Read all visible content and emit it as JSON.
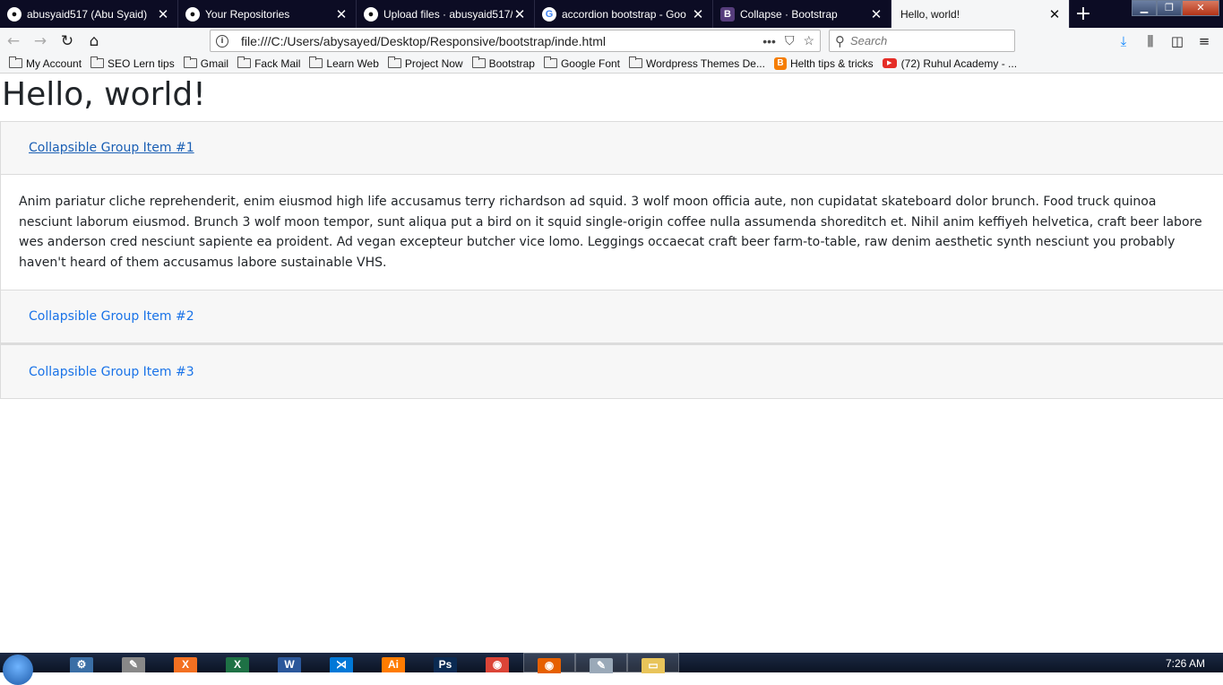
{
  "tabs": [
    {
      "title": "abusyaid517 (Abu Syaid)",
      "icon": "github-icon",
      "active": false
    },
    {
      "title": "Your Repositories",
      "icon": "github-icon",
      "active": false
    },
    {
      "title": "Upload files · abusyaid517/",
      "icon": "github-icon",
      "active": false
    },
    {
      "title": "accordion bootstrap - Goo",
      "icon": "google-icon",
      "active": false
    },
    {
      "title": "Collapse · Bootstrap",
      "icon": "bootstrap-icon",
      "active": false
    },
    {
      "title": "Hello, world!",
      "icon": "none",
      "active": true
    }
  ],
  "glyphs": {
    "close": "✕",
    "new_tab": "+",
    "minimize": "▁",
    "maximize": "❐",
    "window_close": "✕",
    "back": "←",
    "forward": "→",
    "reload": "↻",
    "home": "⌂",
    "info": "i",
    "more": "•••",
    "pocket": "⛉",
    "star": "☆",
    "search": "⚲",
    "download": "⤓",
    "library": "⫼",
    "sidebar": "◫",
    "menu": "≡",
    "github": "●",
    "google": "G",
    "bootstrap": "B",
    "blogger": "B",
    "youtube": "▶"
  },
  "address_bar": {
    "url": "file:///C:/Users/abysayed/Desktop/Responsive/bootstrap/inde.html"
  },
  "search_bar": {
    "placeholder": "Search"
  },
  "bookmarks": [
    {
      "label": "My Account",
      "icon": "folder-icon"
    },
    {
      "label": "SEO Lern tips",
      "icon": "folder-icon"
    },
    {
      "label": "Gmail",
      "icon": "folder-icon"
    },
    {
      "label": "Fack Mail",
      "icon": "folder-icon"
    },
    {
      "label": "Learn Web",
      "icon": "folder-icon"
    },
    {
      "label": "Project Now",
      "icon": "folder-icon"
    },
    {
      "label": "Bootstrap",
      "icon": "folder-icon"
    },
    {
      "label": "Google Font",
      "icon": "folder-icon"
    },
    {
      "label": "Wordpress Themes De...",
      "icon": "folder-icon"
    },
    {
      "label": "Helth tips & tricks",
      "icon": "blogger-icon"
    },
    {
      "label": "(72) Ruhul Academy - ...",
      "icon": "youtube-icon"
    }
  ],
  "page": {
    "heading": "Hello, world!",
    "accordion": [
      {
        "title": "Collapsible Group Item #1",
        "expanded": true,
        "body": "Anim pariatur cliche reprehenderit, enim eiusmod high life accusamus terry richardson ad squid. 3 wolf moon officia aute, non cupidatat skateboard dolor brunch. Food truck quinoa nesciunt laborum eiusmod. Brunch 3 wolf moon tempor, sunt aliqua put a bird on it squid single-origin coffee nulla assumenda shoreditch et. Nihil anim keffiyeh helvetica, craft beer labore wes anderson cred nesciunt sapiente ea proident. Ad vegan excepteur butcher vice lomo. Leggings occaecat craft beer farm-to-table, raw denim aesthetic synth nesciunt you probably haven't heard of them accusamus labore sustainable VHS."
      },
      {
        "title": "Collapsible Group Item #2",
        "expanded": false
      },
      {
        "title": "Collapsible Group Item #3",
        "expanded": false
      }
    ]
  },
  "taskbar": {
    "apps": [
      {
        "name": "taskbar-app-tool",
        "label": "⚙",
        "color": "#3a6ea5"
      },
      {
        "name": "taskbar-app-pen",
        "label": "✎",
        "color": "#888888"
      },
      {
        "name": "taskbar-app-xampp",
        "label": "X",
        "color": "#f37021"
      },
      {
        "name": "taskbar-app-excel",
        "label": "X",
        "color": "#1e7145"
      },
      {
        "name": "taskbar-app-word",
        "label": "W",
        "color": "#2b579a"
      },
      {
        "name": "taskbar-app-vscode",
        "label": "⋊",
        "color": "#0078d7"
      },
      {
        "name": "taskbar-app-illustrator",
        "label": "Ai",
        "color": "#ff7c00"
      },
      {
        "name": "taskbar-app-photoshop",
        "label": "Ps",
        "color": "#0a2a52"
      },
      {
        "name": "taskbar-app-chrome",
        "label": "◉",
        "color": "#db4437"
      },
      {
        "name": "taskbar-app-firefox",
        "label": "◉",
        "color": "#e66000"
      },
      {
        "name": "taskbar-app-notepad",
        "label": "✎",
        "color": "#9aa9b8"
      },
      {
        "name": "taskbar-app-explorer",
        "label": "▭",
        "color": "#e8c45a"
      }
    ],
    "clock": "7:26 AM"
  }
}
